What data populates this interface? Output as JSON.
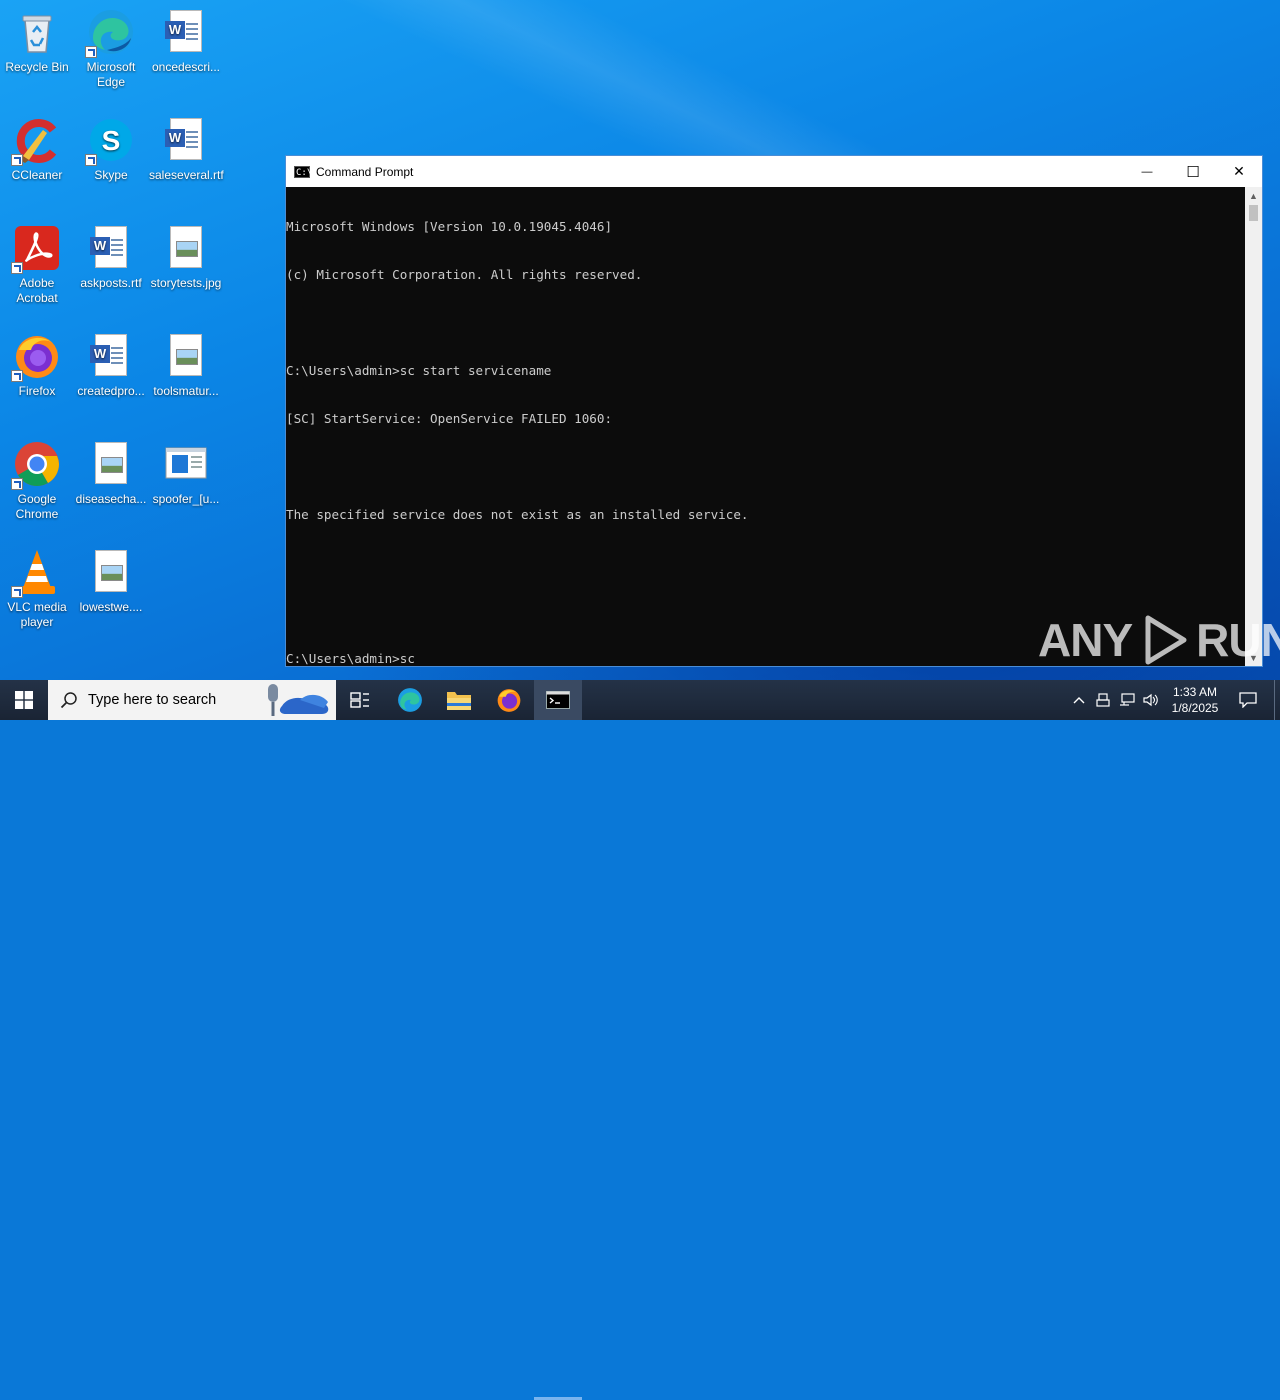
{
  "desktop": {
    "icons": [
      {
        "label": "Recycle Bin",
        "name": "recycle-bin-icon"
      },
      {
        "label": "Microsoft Edge",
        "name": "edge-icon"
      },
      {
        "label": "oncedescri...",
        "name": "word-doc-icon"
      },
      {
        "label": "CCleaner",
        "name": "ccleaner-icon"
      },
      {
        "label": "Skype",
        "name": "skype-icon"
      },
      {
        "label": "saleseveral.rtf",
        "name": "word-doc-icon"
      },
      {
        "label": "Adobe Acrobat",
        "name": "acrobat-icon"
      },
      {
        "label": "askposts.rtf",
        "name": "word-doc-icon"
      },
      {
        "label": "storytests.jpg",
        "name": "image-file-icon"
      },
      {
        "label": "Firefox",
        "name": "firefox-icon"
      },
      {
        "label": "createdpro...",
        "name": "word-doc-icon"
      },
      {
        "label": "toolsmatur...",
        "name": "image-file-icon"
      },
      {
        "label": "Google Chrome",
        "name": "chrome-icon"
      },
      {
        "label": "diseasecha...",
        "name": "image-file-icon"
      },
      {
        "label": "spoofer_[u...",
        "name": "app-window-icon"
      },
      {
        "label": "VLC media player",
        "name": "vlc-icon"
      },
      {
        "label": "lowestwe....",
        "name": "image-file-icon"
      }
    ]
  },
  "cmd": {
    "title": "Command Prompt",
    "icon_text": "C:\\_",
    "lines": [
      "Microsoft Windows [Version 10.0.19045.4046]",
      "(c) Microsoft Corporation. All rights reserved.",
      "",
      "C:\\Users\\admin>sc start servicename",
      "[SC] StartService: OpenService FAILED 1060:",
      "",
      "The specified service does not exist as an installed service.",
      "",
      "",
      "C:\\Users\\admin>sc"
    ],
    "minimize_glyph": "—",
    "maximize_glyph": "☐",
    "close_glyph": "✕"
  },
  "watermark": {
    "left": "ANY",
    "right": "RUN"
  },
  "taskbar": {
    "search_placeholder": "Type here to search",
    "clock_time": "1:33 AM",
    "clock_date": "1/8/2025"
  }
}
